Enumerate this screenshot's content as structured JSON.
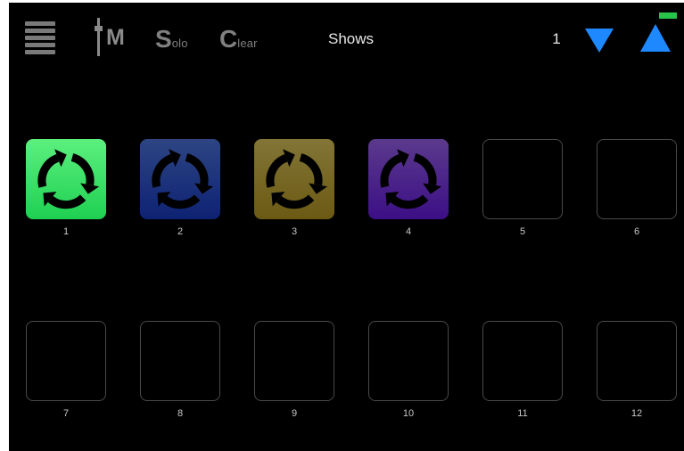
{
  "toolbar": {
    "menu_icon": "hamburger-icon",
    "mute_letter": "M",
    "mute_icon": "fader-icon",
    "solo_big": "S",
    "solo_small": "olo",
    "clear_big": "C",
    "clear_small": "lear",
    "section_title": "Shows",
    "page_number": "1",
    "page_down_icon": "triangle-down-icon",
    "page_up_icon": "triangle-up-icon",
    "status_color": "#27c44a",
    "arrow_color": "#1e88ff"
  },
  "pads": [
    {
      "label": "1",
      "active": true,
      "icon": "cycle-arrows-icon",
      "gradient": [
        "#5cf07e",
        "#1fd052"
      ]
    },
    {
      "label": "2",
      "active": true,
      "icon": "cycle-arrows-icon",
      "gradient": [
        "#2d4583",
        "#0e2273"
      ]
    },
    {
      "label": "3",
      "active": true,
      "icon": "cycle-arrows-icon",
      "gradient": [
        "#827536",
        "#6b5a14"
      ]
    },
    {
      "label": "4",
      "active": true,
      "icon": "cycle-arrows-icon",
      "gradient": [
        "#5b3a8c",
        "#3c0f86"
      ]
    },
    {
      "label": "5",
      "active": false
    },
    {
      "label": "6",
      "active": false
    },
    {
      "label": "7",
      "active": false
    },
    {
      "label": "8",
      "active": false
    },
    {
      "label": "9",
      "active": false
    },
    {
      "label": "10",
      "active": false
    },
    {
      "label": "11",
      "active": false
    },
    {
      "label": "12",
      "active": false
    }
  ]
}
